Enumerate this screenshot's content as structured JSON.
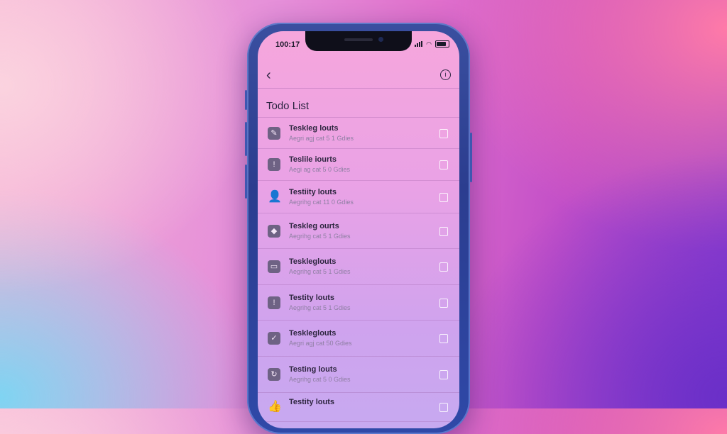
{
  "status_bar": {
    "time": "100:17"
  },
  "nav": {
    "back_icon": "chevron-left-icon",
    "info_icon": "info-icon"
  },
  "page": {
    "title": "Todo List"
  },
  "items": [
    {
      "title": "Teskleg louts",
      "subtitle": "Aegri agj cat 5 1 Gdies",
      "icon": "pen-icon",
      "glyph": "✎"
    },
    {
      "title": "Teslile iourts",
      "subtitle": "Aegi ag cat 5 0 Gdies",
      "icon": "alert-icon",
      "glyph": "!"
    },
    {
      "title": "Testiity louts",
      "subtitle": "Aegrihg cat 11 0 Gdies",
      "icon": "person-icon",
      "glyph": "👤"
    },
    {
      "title": "Teskleg ourts",
      "subtitle": "Aegrihg cat 5 1 Gdies",
      "icon": "briefcase-icon",
      "glyph": "◆"
    },
    {
      "title": "Teskleglouts",
      "subtitle": "Aegrihg cat 5 1 Gdies",
      "icon": "folder-icon",
      "glyph": "▭"
    },
    {
      "title": "Testity louts",
      "subtitle": "Aegrihg cat 5 1 Gdies",
      "icon": "alert-icon",
      "glyph": "!"
    },
    {
      "title": "Teskleglouts",
      "subtitle": "Aegri agj cat 50 Gdies",
      "icon": "check-box-icon",
      "glyph": "✓"
    },
    {
      "title": "Testing louts",
      "subtitle": "Aegrihg cat 5 0 Gdies",
      "icon": "refresh-icon",
      "glyph": "↻"
    },
    {
      "title": "Testity louts",
      "subtitle": "",
      "icon": "thumb-icon",
      "glyph": "👍"
    }
  ],
  "trailing_icon": "tag-icon",
  "colors": {
    "accent": "#e06fcc",
    "screen_top": "#f6a6dc",
    "screen_bottom": "#c7a9f0"
  }
}
